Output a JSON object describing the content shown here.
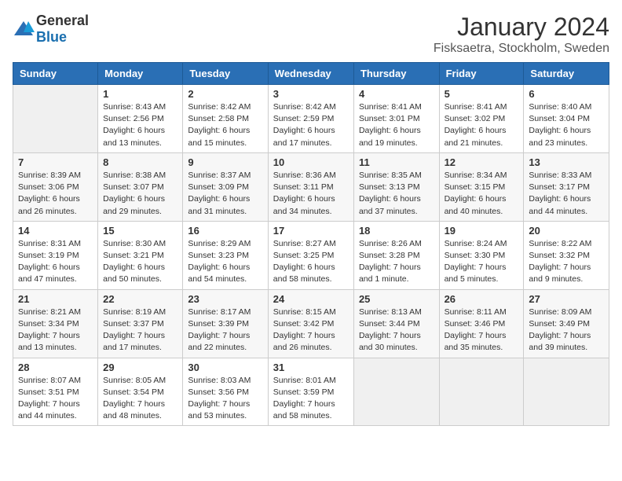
{
  "header": {
    "logo_general": "General",
    "logo_blue": "Blue",
    "month": "January 2024",
    "location": "Fisksaetra, Stockholm, Sweden"
  },
  "days_of_week": [
    "Sunday",
    "Monday",
    "Tuesday",
    "Wednesday",
    "Thursday",
    "Friday",
    "Saturday"
  ],
  "weeks": [
    [
      {
        "num": "",
        "info": ""
      },
      {
        "num": "1",
        "info": "Sunrise: 8:43 AM\nSunset: 2:56 PM\nDaylight: 6 hours\nand 13 minutes."
      },
      {
        "num": "2",
        "info": "Sunrise: 8:42 AM\nSunset: 2:58 PM\nDaylight: 6 hours\nand 15 minutes."
      },
      {
        "num": "3",
        "info": "Sunrise: 8:42 AM\nSunset: 2:59 PM\nDaylight: 6 hours\nand 17 minutes."
      },
      {
        "num": "4",
        "info": "Sunrise: 8:41 AM\nSunset: 3:01 PM\nDaylight: 6 hours\nand 19 minutes."
      },
      {
        "num": "5",
        "info": "Sunrise: 8:41 AM\nSunset: 3:02 PM\nDaylight: 6 hours\nand 21 minutes."
      },
      {
        "num": "6",
        "info": "Sunrise: 8:40 AM\nSunset: 3:04 PM\nDaylight: 6 hours\nand 23 minutes."
      }
    ],
    [
      {
        "num": "7",
        "info": "Sunrise: 8:39 AM\nSunset: 3:06 PM\nDaylight: 6 hours\nand 26 minutes."
      },
      {
        "num": "8",
        "info": "Sunrise: 8:38 AM\nSunset: 3:07 PM\nDaylight: 6 hours\nand 29 minutes."
      },
      {
        "num": "9",
        "info": "Sunrise: 8:37 AM\nSunset: 3:09 PM\nDaylight: 6 hours\nand 31 minutes."
      },
      {
        "num": "10",
        "info": "Sunrise: 8:36 AM\nSunset: 3:11 PM\nDaylight: 6 hours\nand 34 minutes."
      },
      {
        "num": "11",
        "info": "Sunrise: 8:35 AM\nSunset: 3:13 PM\nDaylight: 6 hours\nand 37 minutes."
      },
      {
        "num": "12",
        "info": "Sunrise: 8:34 AM\nSunset: 3:15 PM\nDaylight: 6 hours\nand 40 minutes."
      },
      {
        "num": "13",
        "info": "Sunrise: 8:33 AM\nSunset: 3:17 PM\nDaylight: 6 hours\nand 44 minutes."
      }
    ],
    [
      {
        "num": "14",
        "info": "Sunrise: 8:31 AM\nSunset: 3:19 PM\nDaylight: 6 hours\nand 47 minutes."
      },
      {
        "num": "15",
        "info": "Sunrise: 8:30 AM\nSunset: 3:21 PM\nDaylight: 6 hours\nand 50 minutes."
      },
      {
        "num": "16",
        "info": "Sunrise: 8:29 AM\nSunset: 3:23 PM\nDaylight: 6 hours\nand 54 minutes."
      },
      {
        "num": "17",
        "info": "Sunrise: 8:27 AM\nSunset: 3:25 PM\nDaylight: 6 hours\nand 58 minutes."
      },
      {
        "num": "18",
        "info": "Sunrise: 8:26 AM\nSunset: 3:28 PM\nDaylight: 7 hours\nand 1 minute."
      },
      {
        "num": "19",
        "info": "Sunrise: 8:24 AM\nSunset: 3:30 PM\nDaylight: 7 hours\nand 5 minutes."
      },
      {
        "num": "20",
        "info": "Sunrise: 8:22 AM\nSunset: 3:32 PM\nDaylight: 7 hours\nand 9 minutes."
      }
    ],
    [
      {
        "num": "21",
        "info": "Sunrise: 8:21 AM\nSunset: 3:34 PM\nDaylight: 7 hours\nand 13 minutes."
      },
      {
        "num": "22",
        "info": "Sunrise: 8:19 AM\nSunset: 3:37 PM\nDaylight: 7 hours\nand 17 minutes."
      },
      {
        "num": "23",
        "info": "Sunrise: 8:17 AM\nSunset: 3:39 PM\nDaylight: 7 hours\nand 22 minutes."
      },
      {
        "num": "24",
        "info": "Sunrise: 8:15 AM\nSunset: 3:42 PM\nDaylight: 7 hours\nand 26 minutes."
      },
      {
        "num": "25",
        "info": "Sunrise: 8:13 AM\nSunset: 3:44 PM\nDaylight: 7 hours\nand 30 minutes."
      },
      {
        "num": "26",
        "info": "Sunrise: 8:11 AM\nSunset: 3:46 PM\nDaylight: 7 hours\nand 35 minutes."
      },
      {
        "num": "27",
        "info": "Sunrise: 8:09 AM\nSunset: 3:49 PM\nDaylight: 7 hours\nand 39 minutes."
      }
    ],
    [
      {
        "num": "28",
        "info": "Sunrise: 8:07 AM\nSunset: 3:51 PM\nDaylight: 7 hours\nand 44 minutes."
      },
      {
        "num": "29",
        "info": "Sunrise: 8:05 AM\nSunset: 3:54 PM\nDaylight: 7 hours\nand 48 minutes."
      },
      {
        "num": "30",
        "info": "Sunrise: 8:03 AM\nSunset: 3:56 PM\nDaylight: 7 hours\nand 53 minutes."
      },
      {
        "num": "31",
        "info": "Sunrise: 8:01 AM\nSunset: 3:59 PM\nDaylight: 7 hours\nand 58 minutes."
      },
      {
        "num": "",
        "info": ""
      },
      {
        "num": "",
        "info": ""
      },
      {
        "num": "",
        "info": ""
      }
    ]
  ]
}
